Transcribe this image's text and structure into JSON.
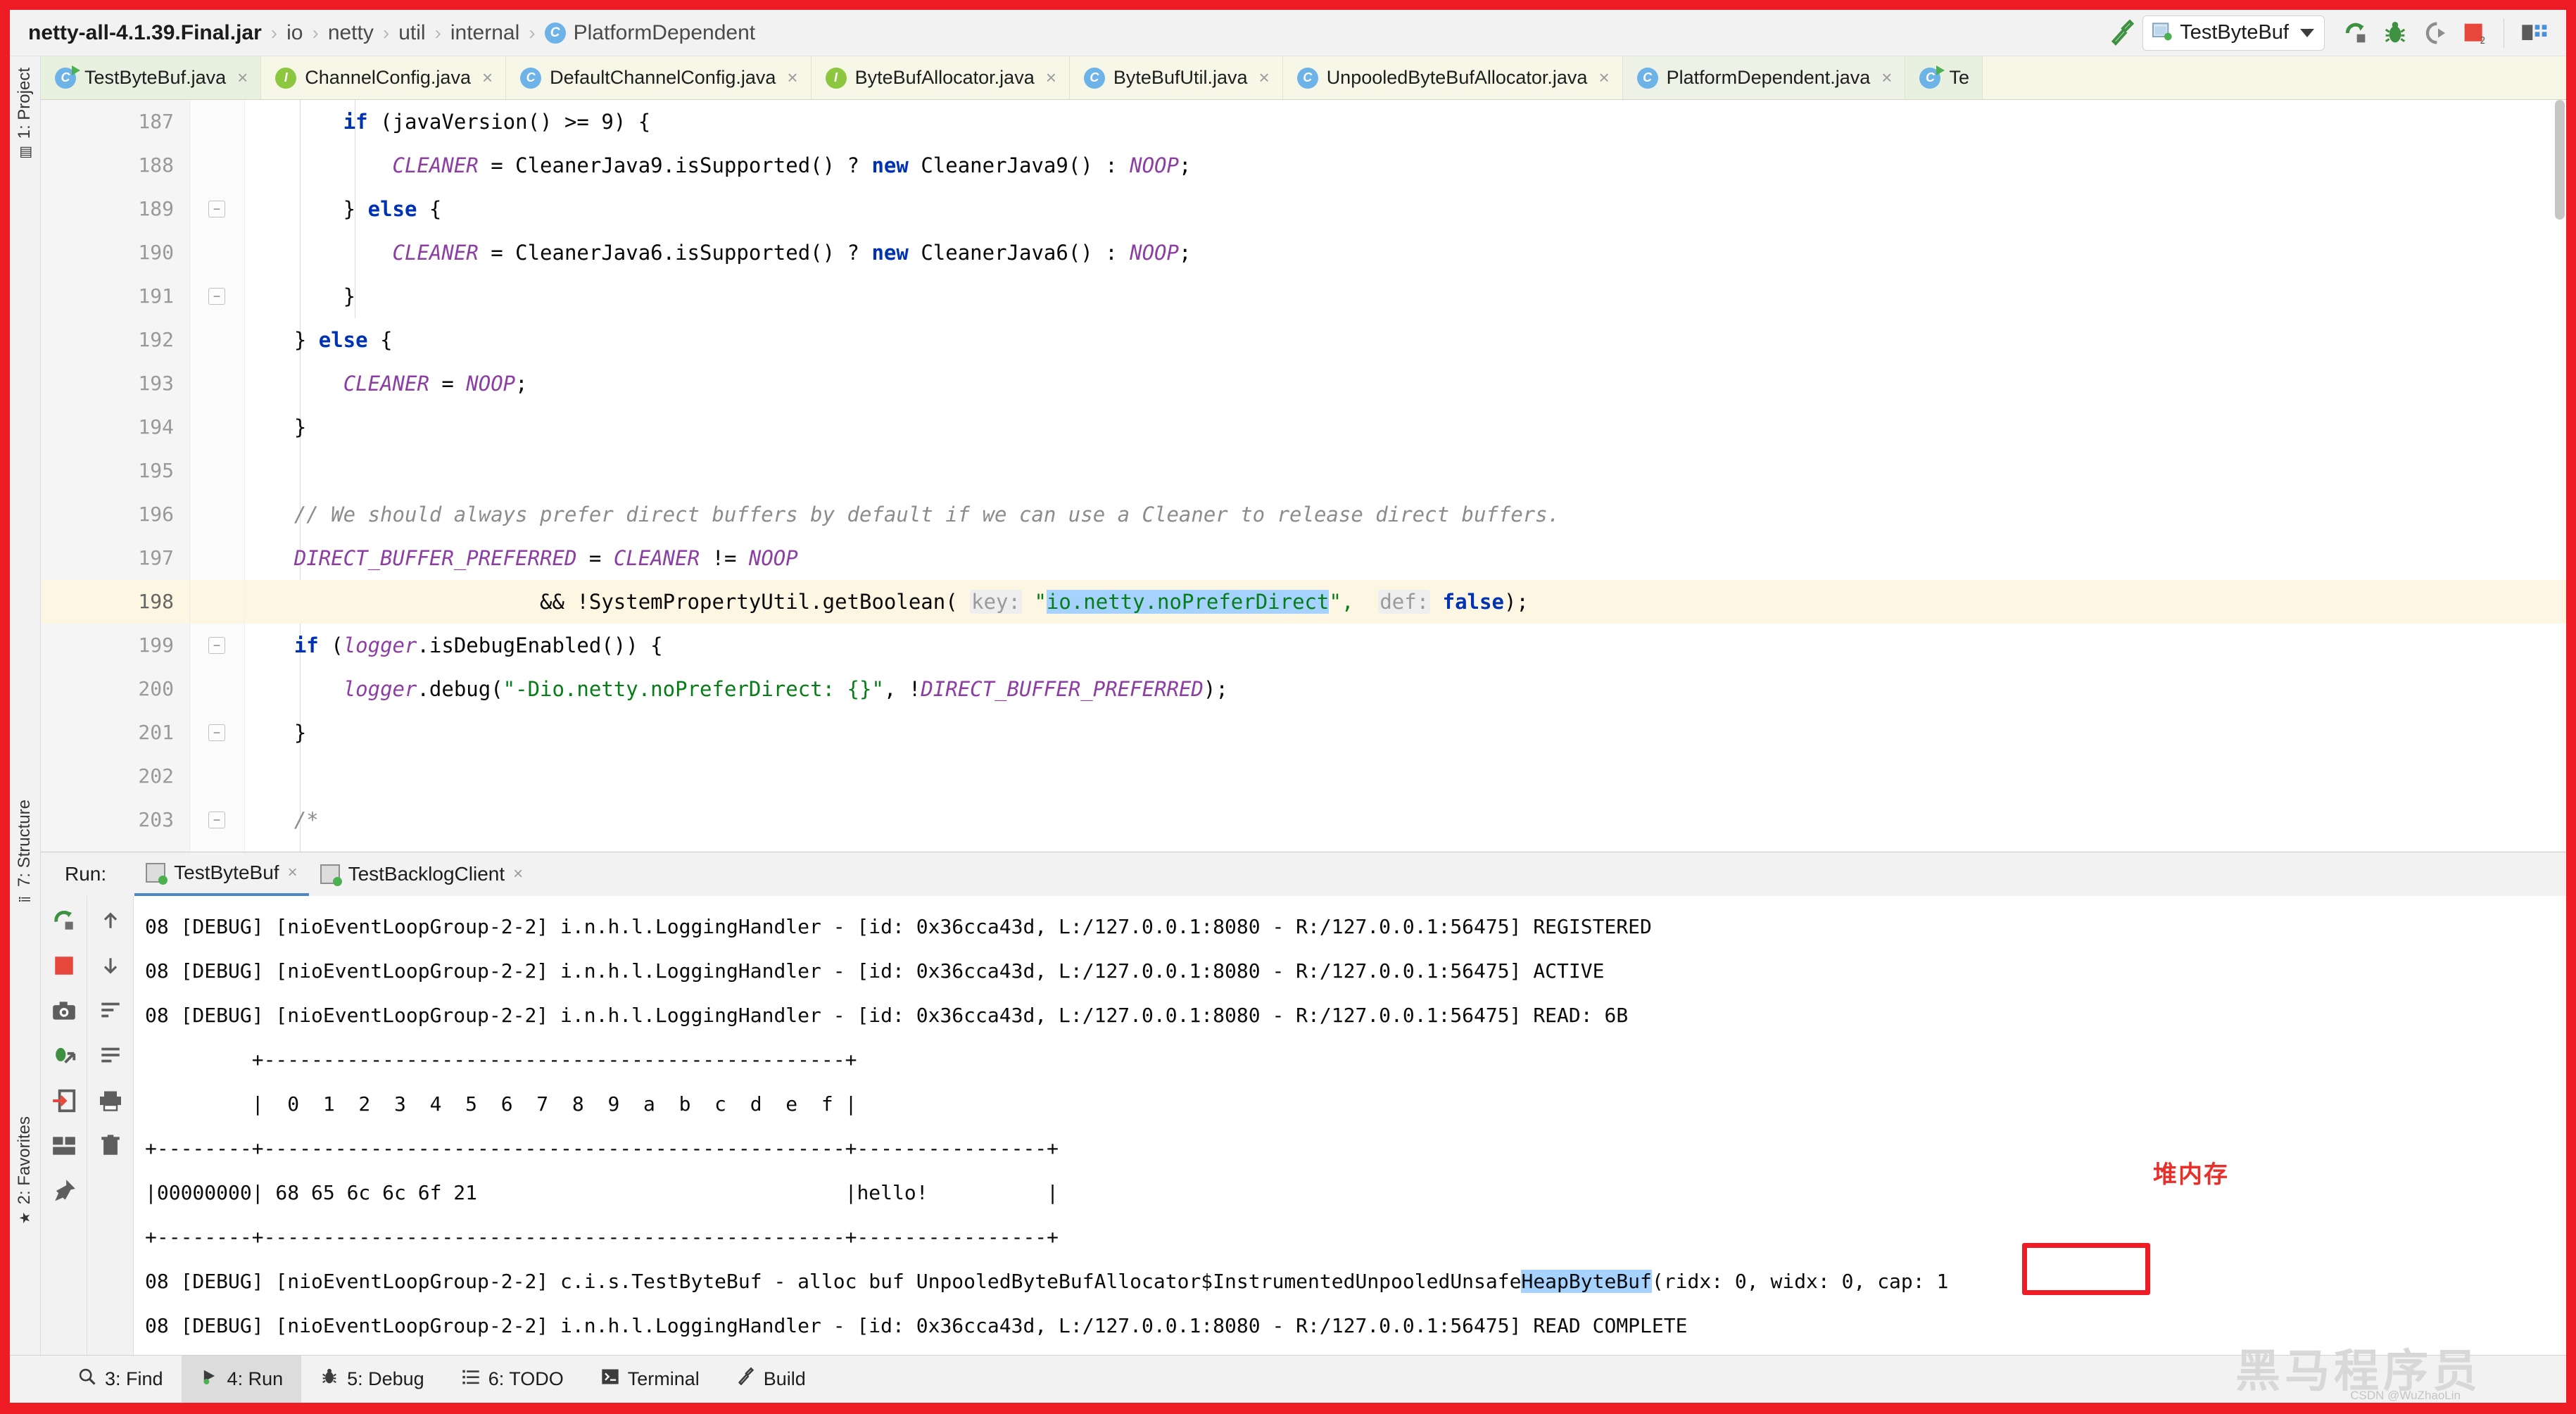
{
  "window": {
    "accent_red": "#ee1c25",
    "breadcrumb": [
      {
        "label": "netty-all-4.1.39.Final.jar",
        "bold": true
      },
      {
        "label": "io",
        "bold": false
      },
      {
        "label": "netty",
        "bold": false
      },
      {
        "label": "util",
        "bold": false
      },
      {
        "label": "internal",
        "bold": false
      },
      {
        "label": "PlatformDependent",
        "bold": false,
        "icon": "class-icon"
      }
    ],
    "separator": "›"
  },
  "toolbar": {
    "build_icon": "hammer-icon",
    "run_config_name": "TestByteBuf",
    "run_config_icon": "application-icon",
    "dropdown_icon": "chevron-down-icon",
    "actions": [
      {
        "name": "run-button",
        "icon": "run-icon"
      },
      {
        "name": "debug-button",
        "icon": "bug-icon"
      },
      {
        "name": "run-with-coverage-button",
        "icon": "coverage-icon"
      },
      {
        "name": "stop-button",
        "icon": "stop-icon"
      },
      {
        "name": "project-structure-button",
        "icon": "structure-icon"
      }
    ]
  },
  "left_strip": {
    "items": [
      {
        "label": "1: Project",
        "icon": "project-icon"
      },
      {
        "label": "7: Structure",
        "icon": "structure-icon"
      },
      {
        "label": "2: Favorites",
        "icon": "star-icon"
      }
    ]
  },
  "editor_tabs": [
    {
      "label": "TestByteBuf.java",
      "icon": "class-icon",
      "kind": "c",
      "runnable": true,
      "state": "selected"
    },
    {
      "label": "ChannelConfig.java",
      "icon": "interface-icon",
      "kind": "i",
      "runnable": false,
      "state": "normal"
    },
    {
      "label": "DefaultChannelConfig.java",
      "icon": "class-icon",
      "kind": "c",
      "runnable": false,
      "state": "normal"
    },
    {
      "label": "ByteBufAllocator.java",
      "icon": "interface-icon",
      "kind": "i",
      "runnable": false,
      "state": "normal"
    },
    {
      "label": "ByteBufUtil.java",
      "icon": "class-icon",
      "kind": "c",
      "runnable": false,
      "state": "normal"
    },
    {
      "label": "UnpooledByteBufAllocator.java",
      "icon": "class-icon",
      "kind": "c",
      "runnable": false,
      "state": "normal"
    },
    {
      "label": "PlatformDependent.java",
      "icon": "class-icon",
      "kind": "c",
      "runnable": false,
      "state": "active"
    },
    {
      "label": "Te",
      "icon": "class-icon",
      "kind": "c",
      "runnable": true,
      "state": "cut"
    }
  ],
  "editor": {
    "close_glyph": "×",
    "fold_glyph": "−",
    "lines": [
      {
        "num": "187",
        "fold": false,
        "highlight": false,
        "clipped": true,
        "segments": [
          {
            "t": "        ",
            "c": "pl"
          },
          {
            "t": "if",
            "c": "kw"
          },
          {
            "t": " (javaVersion() >= ",
            "c": "pl"
          },
          {
            "t": "9",
            "c": "pl"
          },
          {
            "t": ") {",
            "c": "pl"
          }
        ]
      },
      {
        "num": "188",
        "fold": false,
        "highlight": false,
        "segments": [
          {
            "t": "            ",
            "c": "pl"
          },
          {
            "t": "CLEANER",
            "c": "sfield"
          },
          {
            "t": " = CleanerJava9.",
            "c": "pl"
          },
          {
            "t": "isSupported",
            "c": "pl"
          },
          {
            "t": "() ? ",
            "c": "pl"
          },
          {
            "t": "new",
            "c": "kw"
          },
          {
            "t": " CleanerJava9() : ",
            "c": "pl"
          },
          {
            "t": "NOOP",
            "c": "sfield"
          },
          {
            "t": ";",
            "c": "pl"
          }
        ]
      },
      {
        "num": "189",
        "fold": true,
        "highlight": false,
        "segments": [
          {
            "t": "        } ",
            "c": "pl"
          },
          {
            "t": "else",
            "c": "kw"
          },
          {
            "t": " {",
            "c": "pl"
          }
        ]
      },
      {
        "num": "190",
        "fold": false,
        "highlight": false,
        "segments": [
          {
            "t": "            ",
            "c": "pl"
          },
          {
            "t": "CLEANER",
            "c": "sfield"
          },
          {
            "t": " = CleanerJava6.",
            "c": "pl"
          },
          {
            "t": "isSupported",
            "c": "pl"
          },
          {
            "t": "() ? ",
            "c": "pl"
          },
          {
            "t": "new",
            "c": "kw"
          },
          {
            "t": " CleanerJava6() : ",
            "c": "pl"
          },
          {
            "t": "NOOP",
            "c": "sfield"
          },
          {
            "t": ";",
            "c": "pl"
          }
        ]
      },
      {
        "num": "191",
        "fold": true,
        "highlight": false,
        "segments": [
          {
            "t": "        }",
            "c": "pl"
          }
        ]
      },
      {
        "num": "192",
        "fold": false,
        "highlight": false,
        "segments": [
          {
            "t": "    } ",
            "c": "pl"
          },
          {
            "t": "else",
            "c": "kw"
          },
          {
            "t": " {",
            "c": "pl"
          }
        ]
      },
      {
        "num": "193",
        "fold": false,
        "highlight": false,
        "segments": [
          {
            "t": "        ",
            "c": "pl"
          },
          {
            "t": "CLEANER",
            "c": "sfield"
          },
          {
            "t": " = ",
            "c": "pl"
          },
          {
            "t": "NOOP",
            "c": "sfield"
          },
          {
            "t": ";",
            "c": "pl"
          }
        ]
      },
      {
        "num": "194",
        "fold": false,
        "highlight": false,
        "segments": [
          {
            "t": "    }",
            "c": "pl"
          }
        ]
      },
      {
        "num": "195",
        "fold": false,
        "highlight": false,
        "segments": []
      },
      {
        "num": "196",
        "fold": false,
        "highlight": false,
        "segments": [
          {
            "t": "    // We should always prefer direct buffers by default if we can use a Cleaner to release direct buffers.",
            "c": "cmt"
          }
        ]
      },
      {
        "num": "197",
        "fold": false,
        "highlight": false,
        "segments": [
          {
            "t": "    ",
            "c": "pl"
          },
          {
            "t": "DIRECT_BUFFER_PREFERRED",
            "c": "sfield"
          },
          {
            "t": " = ",
            "c": "pl"
          },
          {
            "t": "CLEANER",
            "c": "sfield"
          },
          {
            "t": " != ",
            "c": "pl"
          },
          {
            "t": "NOOP",
            "c": "sfield"
          }
        ]
      },
      {
        "num": "198",
        "fold": false,
        "highlight": true,
        "segments": [
          {
            "t": "                        && !SystemPropertyUtil.",
            "c": "pl"
          },
          {
            "t": "getBoolean",
            "c": "pl"
          },
          {
            "t": "( ",
            "c": "pl"
          },
          {
            "t": "key:",
            "c": "hint"
          },
          {
            "t": " \"",
            "c": "str"
          },
          {
            "t": "io.netty.noPreferDirect",
            "c": "sel-str"
          },
          {
            "t": "\",  ",
            "c": "str"
          },
          {
            "t": "def:",
            "c": "hint"
          },
          {
            "t": " ",
            "c": "pl"
          },
          {
            "t": "false",
            "c": "kw"
          },
          {
            "t": ");",
            "c": "pl"
          }
        ]
      },
      {
        "num": "199",
        "fold": true,
        "highlight": false,
        "segments": [
          {
            "t": "    ",
            "c": "pl"
          },
          {
            "t": "if",
            "c": "kw"
          },
          {
            "t": " (",
            "c": "pl"
          },
          {
            "t": "logger",
            "c": "sfield"
          },
          {
            "t": ".isDebugEnabled()) {",
            "c": "pl"
          }
        ]
      },
      {
        "num": "200",
        "fold": false,
        "highlight": false,
        "segments": [
          {
            "t": "        ",
            "c": "pl"
          },
          {
            "t": "logger",
            "c": "sfield"
          },
          {
            "t": ".debug(",
            "c": "pl"
          },
          {
            "t": "\"-Dio.netty.noPreferDirect: {}\"",
            "c": "str"
          },
          {
            "t": ", !",
            "c": "pl"
          },
          {
            "t": "DIRECT_BUFFER_PREFERRED",
            "c": "sfield"
          },
          {
            "t": ");",
            "c": "pl"
          }
        ]
      },
      {
        "num": "201",
        "fold": true,
        "highlight": false,
        "segments": [
          {
            "t": "    }",
            "c": "pl"
          }
        ]
      },
      {
        "num": "202",
        "fold": false,
        "highlight": false,
        "segments": []
      },
      {
        "num": "203",
        "fold": true,
        "highlight": false,
        "segments": [
          {
            "t": "    /*",
            "c": "cmt"
          }
        ]
      }
    ]
  },
  "run_window": {
    "label": "Run:",
    "tabs": [
      {
        "label": "TestByteBuf",
        "active": true
      },
      {
        "label": "TestBacklogClient",
        "active": false
      }
    ],
    "close_glyph": "×",
    "tools_left": [
      {
        "name": "rerun-button",
        "icon": "rerun-icon"
      },
      {
        "name": "stop-button",
        "icon": "stop-square-icon"
      },
      {
        "name": "camera-button",
        "icon": "camera-icon"
      },
      {
        "name": "attach-debugger-button",
        "icon": "bug-attach-icon"
      },
      {
        "name": "jump-to-source-button",
        "icon": "arrow-into-box-icon"
      },
      {
        "name": "layout-button",
        "icon": "layout-icon"
      },
      {
        "name": "pin-button",
        "icon": "pin-icon"
      }
    ],
    "tools_right": [
      {
        "name": "scroll-up-button",
        "icon": "arrow-up-icon"
      },
      {
        "name": "scroll-down-button",
        "icon": "arrow-down-icon"
      },
      {
        "name": "soft-wrap-button",
        "icon": "wrap-icon"
      },
      {
        "name": "scroll-to-end-button",
        "icon": "scroll-end-icon"
      },
      {
        "name": "print-button",
        "icon": "printer-icon"
      },
      {
        "name": "clear-all-button",
        "icon": "trash-icon"
      }
    ],
    "console_lines": [
      "08 [DEBUG] [nioEventLoopGroup-2-2] i.n.h.l.LoggingHandler - [id: 0x36cca43d, L:/127.0.0.1:8080 - R:/127.0.0.1:56475] REGISTERED",
      "08 [DEBUG] [nioEventLoopGroup-2-2] i.n.h.l.LoggingHandler - [id: 0x36cca43d, L:/127.0.0.1:8080 - R:/127.0.0.1:56475] ACTIVE",
      "08 [DEBUG] [nioEventLoopGroup-2-2] i.n.h.l.LoggingHandler - [id: 0x36cca43d, L:/127.0.0.1:8080 - R:/127.0.0.1:56475] READ: 6B",
      "         +-------------------------------------------------+",
      "         |  0  1  2  3  4  5  6  7  8  9  a  b  c  d  e  f |",
      "+--------+-------------------------------------------------+----------------+",
      "|00000000| 68 65 6c 6c 6f 21                               |hello!          |",
      "+--------+-------------------------------------------------+----------------+"
    ],
    "alloc_line_prefix": "08 [DEBUG] [nioEventLoopGroup-2-2] c.i.s.TestByteBuf - alloc buf UnpooledByteBufAllocator$InstrumentedUnpooledUnsafe",
    "alloc_line_highlight": "HeapByteBuf",
    "alloc_line_suffix": "(ridx: 0, widx: 0, cap: 1",
    "final_line": "08 [DEBUG] [nioEventLoopGroup-2-2] i.n.h.l.LoggingHandler - [id: 0x36cca43d, L:/127.0.0.1:8080 - R:/127.0.0.1:56475] READ COMPLETE"
  },
  "annotations": [
    {
      "name": "heap-memory-annotation",
      "text": "堆内存",
      "color": "#e8302a"
    }
  ],
  "status_bar": {
    "items": [
      {
        "label": "3: Find",
        "icon": "search-icon",
        "mnemonic": "3",
        "active": false
      },
      {
        "label": "4: Run",
        "icon": "run-icon",
        "mnemonic": "4",
        "active": true
      },
      {
        "label": "5: Debug",
        "icon": "bug-icon",
        "mnemonic": "5",
        "active": false
      },
      {
        "label": "6: TODO",
        "icon": "list-icon",
        "mnemonic": "6",
        "active": false
      },
      {
        "label": "Terminal",
        "icon": "terminal-icon",
        "mnemonic": "",
        "active": false
      },
      {
        "label": "Build",
        "icon": "hammer-icon",
        "mnemonic": "",
        "active": false
      }
    ]
  },
  "watermark": {
    "text": "黑马程序员",
    "sub": "CSDN @WuZhaoLin"
  }
}
